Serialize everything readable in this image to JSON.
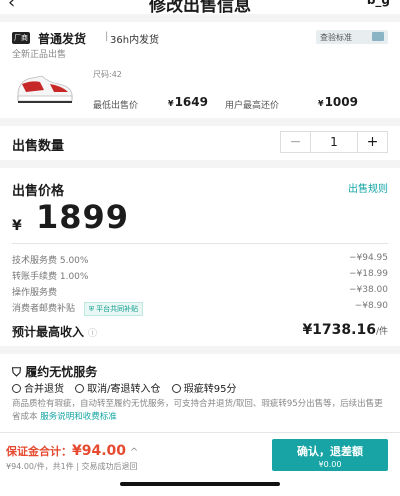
{
  "nav": {
    "back_icon": "‹",
    "title": "修改出售信息",
    "more_label": "b_g"
  },
  "product": {
    "ship_tag": "厂商",
    "ship_type": "普通发货",
    "separator": "|",
    "ship_time": "36h内发货",
    "inspection_label": "查验标准",
    "condition": "全新正品出售",
    "size": "尺码:42",
    "min_price_label": "最低出售价",
    "min_price": "1649",
    "max_offer_label": "用户最高还价",
    "max_offer": "1009",
    "currency": "¥"
  },
  "quantity": {
    "label": "出售数量",
    "minus": "−",
    "value": "1",
    "plus": "+"
  },
  "price": {
    "label": "出售价格",
    "rules_link": "出售规则",
    "currency": "¥",
    "value": "1899",
    "fees": [
      {
        "label": "技术服务费 5.00%",
        "value": "−¥94.95"
      },
      {
        "label": "转账手续费 1.00%",
        "value": "−¥18.99"
      },
      {
        "label": "操作服务费",
        "value": "−¥38.00"
      },
      {
        "label": "消费者邮费补贴",
        "value": "−¥8.90"
      }
    ],
    "subsidy_badge": "平台共同补贴",
    "estimate_label": "预计最高收入",
    "estimate_value": "¥1738.16",
    "estimate_unit": "/件"
  },
  "service": {
    "title": "履约无忧服务",
    "items": [
      "合并退货",
      "取消/寄退转入仓",
      "瑕疵转95分"
    ],
    "desc": "商品质检有瑕疵，自动转至履约无忧服务，可支持合并退货/取回、瑕疵转95分出售等，后续出售更省成本",
    "link": "服务说明和收费标准"
  },
  "bottom": {
    "deposit_label": "保证金合计：",
    "deposit_amount": "¥94.00",
    "chevron": "^",
    "deposit_sub": "¥94.00/件，共1件 | 交易成功后退回",
    "confirm_label": "确认，退差额",
    "confirm_sub": "¥0.00"
  },
  "colors": {
    "accent": "#16a5a5",
    "deposit": "#e64a30"
  }
}
